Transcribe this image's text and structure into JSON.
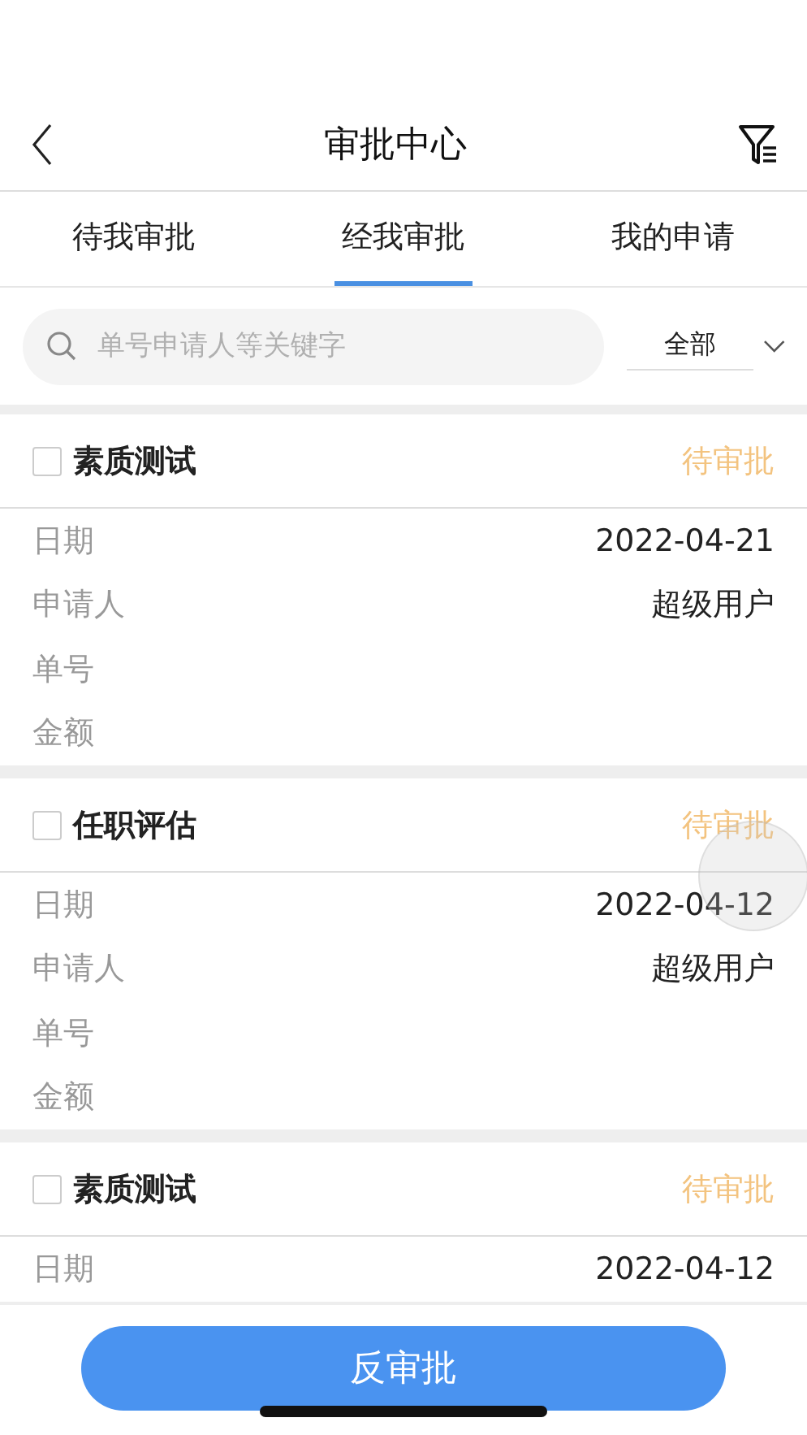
{
  "header": {
    "title": "审批中心"
  },
  "tabs": [
    {
      "label": "待我审批",
      "selected": false
    },
    {
      "label": "经我审批",
      "selected": true
    },
    {
      "label": "我的申请",
      "selected": false
    }
  ],
  "search": {
    "placeholder": "单号申请人等关键字"
  },
  "filter": {
    "value": "全部"
  },
  "cards": [
    {
      "title": "素质测试",
      "checked": false,
      "status": "待审批",
      "fields": [
        {
          "label": "日期",
          "value": "2022-04-21"
        },
        {
          "label": "申请人",
          "value": "超级用户"
        },
        {
          "label": "单号"
        },
        {
          "label": "金额"
        }
      ]
    },
    {
      "title": "任职评估",
      "checked": false,
      "status": "待审批",
      "fields": [
        {
          "label": "日期",
          "value": "2022-04-12"
        },
        {
          "label": "申请人",
          "value": "超级用户"
        },
        {
          "label": "单号"
        },
        {
          "label": "金额"
        }
      ]
    },
    {
      "title": "素质测试",
      "checked": false,
      "status": "待审批",
      "fields": [
        {
          "label": "日期",
          "value": "2022-04-12"
        }
      ]
    }
  ],
  "action_button": "反审批"
}
